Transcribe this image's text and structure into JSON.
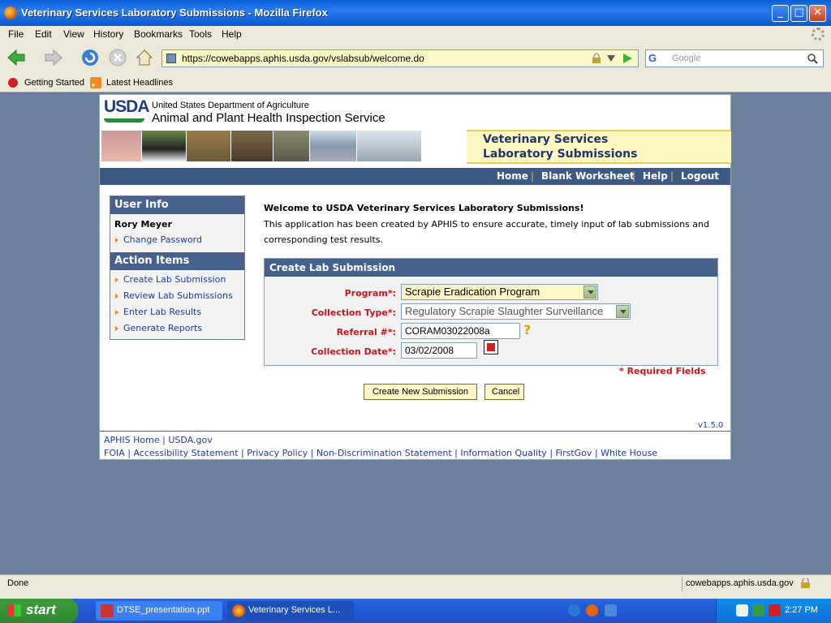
{
  "window": {
    "title": "Veterinary Services Laboratory Submissions - Mozilla Firefox",
    "controls": {
      "minimize": "_",
      "maximize": "□",
      "close": "✕"
    }
  },
  "menu": [
    "File",
    "Edit",
    "View",
    "History",
    "Bookmarks",
    "Tools",
    "Help"
  ],
  "navbar": {
    "url": "https://cowebapps.aphis.usda.gov/vslabsub/welcome.do",
    "search_placeholder": "Google",
    "search_engine_letter": "G"
  },
  "bookmarks": [
    "Getting Started",
    "Latest Headlines"
  ],
  "header": {
    "logo_text": "USDA",
    "agency_line1": "United States Department of Agriculture",
    "agency_line2": "Animal and Plant Health Inspection Service",
    "banner_line1": "Veterinary Services",
    "banner_line2": "Laboratory Submissions"
  },
  "topnav": [
    "Home",
    "Blank Worksheet",
    "Help",
    "Logout"
  ],
  "sidebar": {
    "user_info_title": "User Info",
    "user_name": "Rory Meyer",
    "change_password": "Change Password",
    "action_items_title": "Action Items",
    "actions": [
      "Create Lab Submission",
      "Review Lab Submissions",
      "Enter Lab Results",
      "Generate Reports"
    ]
  },
  "main": {
    "welcome_title": "Welcome to USDA Veterinary Services Laboratory Submissions!",
    "welcome_body": "This application has been created by APHIS to ensure accurate, timely input of lab submissions and corresponding test results."
  },
  "form": {
    "title": "Create Lab Submission",
    "program_label": "Program*:",
    "program_value": "Scrapie Eradication Program",
    "collection_type_label": "Collection Type*:",
    "collection_type_value": "Regulatory Scrapie Slaughter Surveillance",
    "referral_label": "Referral #*:",
    "referral_value": "CORAM03022008a",
    "collection_date_label": "Collection Date*:",
    "collection_date_value": "03/02/2008",
    "help_mark": "?",
    "required_note": "* Required Fields",
    "create_button": "Create New Submission",
    "cancel_button": "Cancel"
  },
  "version": "v1.5.0",
  "footer": {
    "line1": [
      "APHIS Home",
      "USDA.gov"
    ],
    "line2": [
      "FOIA",
      "Accessibility Statement",
      "Privacy Policy",
      "Non-Discrimination Statement",
      "Information Quality",
      "FirstGov",
      "White House"
    ]
  },
  "status": {
    "text": "Done",
    "host": "cowebapps.aphis.usda.gov"
  },
  "taskbar": {
    "start": "start",
    "tasks": [
      "DTSE_presentation.ppt",
      "Veterinary Services L..."
    ],
    "clock": "2:27 PM"
  },
  "colors": {
    "nav_blue": "#3d5a84",
    "required_red": "#c8141e",
    "link_blue": "#1f3d9a",
    "banner_yellow": "#fcf6c0"
  }
}
